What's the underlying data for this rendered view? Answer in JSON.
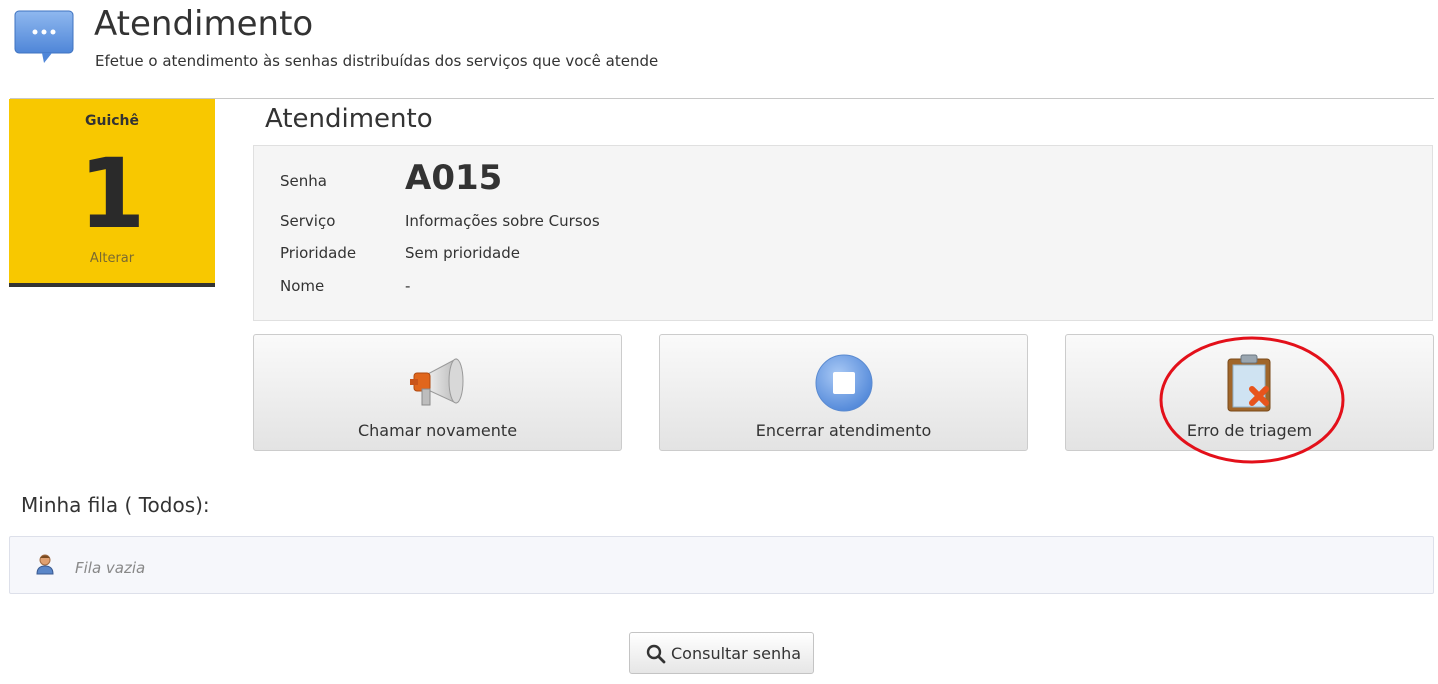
{
  "header": {
    "title": "Atendimento",
    "subtitle": "Efetue o atendimento às senhas distribuídas dos serviços que você atende",
    "icon": "chat-bubble-icon"
  },
  "guiche": {
    "label": "Guichê",
    "number": "1",
    "change_link": "Alterar",
    "color": "#f8c800"
  },
  "attendance": {
    "section_title": "Atendimento",
    "fields": [
      {
        "label": "Senha",
        "value": "A015"
      },
      {
        "label": "Serviço",
        "value": "Informações sobre Cursos"
      },
      {
        "label": "Prioridade",
        "value": "Sem prioridade"
      },
      {
        "label": "Nome",
        "value": "-"
      }
    ]
  },
  "actions": [
    {
      "label": "Chamar novamente",
      "icon": "megaphone-icon"
    },
    {
      "label": "Encerrar atendimento",
      "icon": "stop-icon"
    },
    {
      "label": "Erro de triagem",
      "icon": "clipboard-error-icon",
      "highlight_color": "#e3101a"
    }
  ],
  "queue": {
    "title": "Minha fila ( Todos):",
    "empty_text": "Fila vazia",
    "icon": "user-icon"
  },
  "consult": {
    "label": "Consultar senha",
    "icon": "search-icon"
  }
}
